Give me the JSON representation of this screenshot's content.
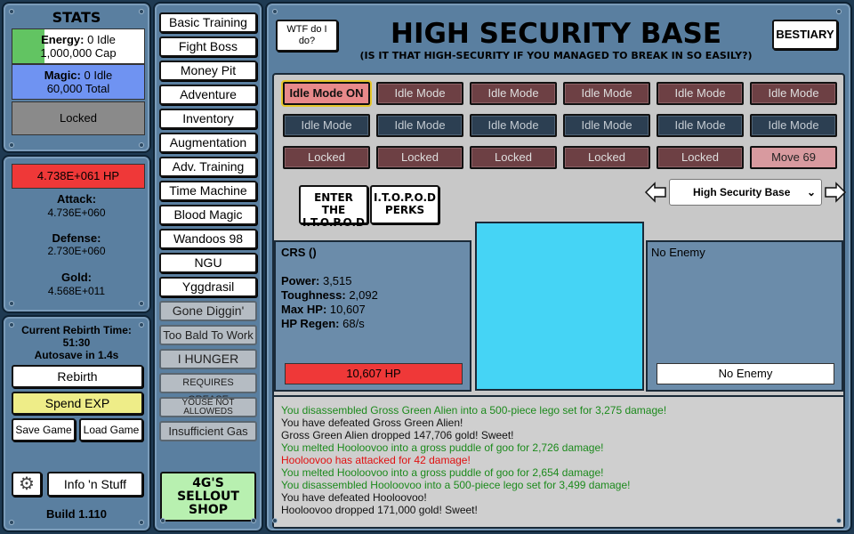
{
  "left": {
    "stats_title": "STATS",
    "energy": {
      "label": "Energy:",
      "idle": "0 Idle",
      "cap": "1,000,000 Cap"
    },
    "magic": {
      "label": "Magic:",
      "idle": "0 Idle",
      "total": "60,000 Total"
    },
    "locked": "Locked",
    "hp": "4.738E+061 HP",
    "attack": {
      "label": "Attack:",
      "value": "4.736E+060"
    },
    "defense": {
      "label": "Defense:",
      "value": "2.730E+060"
    },
    "gold": {
      "label": "Gold:",
      "value": "4.568E+011"
    },
    "rebirth_time_label": "Current Rebirth Time:",
    "rebirth_time": "51:30",
    "autosave": "Autosave in 1.4s",
    "rebirth_button": "Rebirth",
    "spend_exp_button": "Spend EXP",
    "save_button": "Save Game",
    "load_button": "Load Game",
    "info_button": "Info 'n Stuff",
    "build": "Build 1.110"
  },
  "menu": {
    "items": [
      "Basic Training",
      "Fight Boss",
      "Money Pit",
      "Adventure",
      "Inventory",
      "Augmentation",
      "Adv. Training",
      "Time Machine",
      "Blood Magic",
      "Wandoos 98",
      "NGU",
      "Yggdrasil"
    ],
    "disabled": [
      "Gone Diggin'",
      "Too Bald To Work",
      "I HUNGER",
      "REQUIRES GREASE",
      "YOUSE NOT ALLOWEDS",
      "Insufficient Gas"
    ],
    "shop": "4G'S SELLOUT SHOP"
  },
  "header": {
    "help_button": "WTF do I do?",
    "title": "HIGH SECURITY BASE",
    "subtitle": "(IS IT THAT HIGH-SECURITY IF YOU MANAGED TO BREAK IN SO EASILY?)",
    "bestiary_button": "BESTIARY"
  },
  "zones": {
    "row1": [
      "Idle Mode ON",
      "Idle Mode",
      "Idle Mode",
      "Idle Mode",
      "Idle Mode",
      "Idle Mode"
    ],
    "row2": [
      "Idle Mode",
      "Idle Mode",
      "Idle Mode",
      "Idle Mode",
      "Idle Mode",
      "Idle Mode"
    ],
    "row3": [
      "Locked",
      "Locked",
      "Locked",
      "Locked",
      "Locked",
      "Move 69"
    ]
  },
  "itopod": {
    "enter": "ENTER THE I.T.O.P.O.D",
    "perks": "I.T.O.P.O.D PERKS"
  },
  "zone_select": {
    "selected": "High Security Base"
  },
  "player": {
    "name": "CRS ()",
    "power_label": "Power:",
    "power": "3,515",
    "toughness_label": "Toughness:",
    "toughness": "2,092",
    "maxhp_label": "Max HP:",
    "maxhp": "10,607",
    "regen_label": "HP Regen:",
    "regen": "68/s",
    "hp_bar": "10,607 HP"
  },
  "enemy": {
    "name": "No Enemy",
    "hp_bar": "No Enemy"
  },
  "log": [
    {
      "text": "You disassembled Gross Green Alien into a 500-piece lego set for 3,275 damage!",
      "color": "#1c8a1c"
    },
    {
      "text": "You have defeated Gross Green Alien!",
      "color": "#111111"
    },
    {
      "text": "Gross Green Alien dropped 147,706 gold! Sweet!",
      "color": "#111111"
    },
    {
      "text": "You melted Hooloovoo into a gross puddle of goo for 2,726 damage!",
      "color": "#1c8a1c"
    },
    {
      "text": "Hooloovoo has attacked for 42 damage!",
      "color": "#e01010"
    },
    {
      "text": "You melted Hooloovoo into a gross puddle of goo for 2,654 damage!",
      "color": "#1c8a1c"
    },
    {
      "text": "You disassembled Hooloovoo into a 500-piece lego set for 3,499 damage!",
      "color": "#1c8a1c"
    },
    {
      "text": "You have defeated Hooloovoo!",
      "color": "#111111"
    },
    {
      "text": "Hooloovoo dropped 171,000 gold! Sweet!",
      "color": "#111111"
    }
  ],
  "colors": {
    "energy": "#62c462",
    "magic": "#6f93f2",
    "hp": "#ef3838",
    "enemy_tile": "#45d4f5",
    "spend": "#eeed88",
    "shop": "#b8f0b0"
  }
}
